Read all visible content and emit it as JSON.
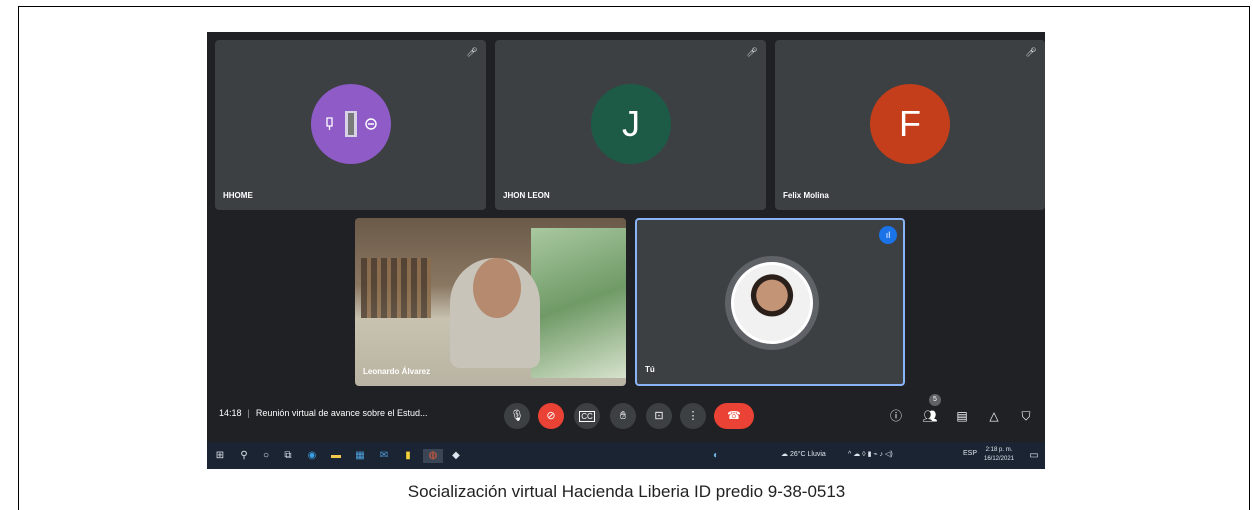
{
  "participants": [
    {
      "name": "HHOME",
      "type": "logo",
      "avatar_color": "#8e5bc7",
      "muted": true
    },
    {
      "name": "JHON LEON",
      "initial": "J",
      "avatar_color": "#1e5b47",
      "muted": true
    },
    {
      "name": "Felix Molina",
      "initial": "F",
      "avatar_color": "#c43e1c",
      "muted": true
    },
    {
      "name": "Leonardo Álvarez",
      "type": "video"
    },
    {
      "name": "Tú",
      "type": "photo",
      "speaking": true
    }
  ],
  "bottombar": {
    "time": "14:18",
    "meeting_title": "Reunión virtual de avance sobre el Estud...",
    "participant_count": "5"
  },
  "taskbar": {
    "weather": "26°C Lluvia",
    "language": "ESP",
    "time": "2:18 p. m.",
    "date": "16/12/2021"
  },
  "caption": "Socialización virtual  Hacienda Liberia  ID predio  9-38-0513",
  "colors": {
    "accent_blue": "#8ab4f8",
    "hangup_red": "#ea4335",
    "meet_bg": "#202124"
  }
}
